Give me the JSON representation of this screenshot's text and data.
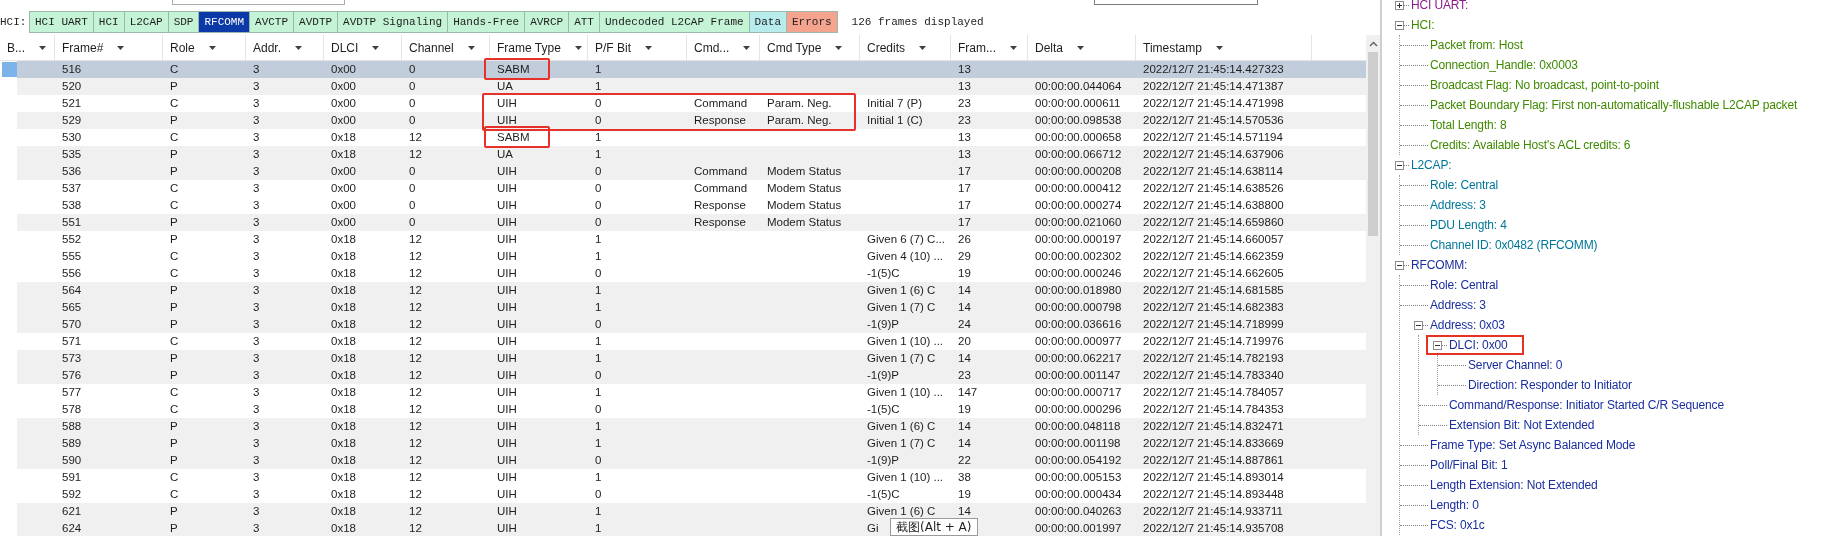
{
  "protocol_bar": {
    "label": "HCI:",
    "tabs": [
      {
        "label": "HCI UART",
        "selected": false,
        "color": "#c4f3d6"
      },
      {
        "label": "HCI",
        "selected": false,
        "color": "#c4f3d6"
      },
      {
        "label": "L2CAP",
        "selected": false,
        "color": "#c4f3d6"
      },
      {
        "label": "SDP",
        "selected": false,
        "color": "#c4f3d6"
      },
      {
        "label": "RFCOMM",
        "selected": true,
        "color": "#0b3aa8"
      },
      {
        "label": "AVCTP",
        "selected": false,
        "color": "#c4f3d6"
      },
      {
        "label": "AVDTP",
        "selected": false,
        "color": "#c4f3d6"
      },
      {
        "label": "AVDTP Signaling",
        "selected": false,
        "color": "#c4f3d6"
      },
      {
        "label": "Hands-Free",
        "selected": false,
        "color": "#c4f3d6"
      },
      {
        "label": "AVRCP",
        "selected": false,
        "color": "#c4f3d6"
      },
      {
        "label": "ATT",
        "selected": false,
        "color": "#c4f3d6"
      },
      {
        "label": "Undecoded L2CAP Frame",
        "selected": false,
        "color": "#c4f3d6"
      },
      {
        "label": "Data",
        "selected": false,
        "color": "#b8ecec"
      },
      {
        "label": "Errors",
        "selected": false,
        "color": "#f4a48e"
      }
    ],
    "frame_count": "126 frames displayed"
  },
  "table": {
    "columns": [
      "B...",
      "Frame#",
      "Role",
      "Addr.",
      "DLCI",
      "Channel",
      "Frame Type",
      "P/F Bit",
      "Cmd...",
      "Cmd Type",
      "Credits",
      "Fram...",
      "Delta",
      "Timestamp"
    ],
    "rows": [
      {
        "selected": true,
        "boxed": true,
        "frame": "516",
        "role": "C",
        "address": "3",
        "dlci": "0x00",
        "channel": "0",
        "frame_type": "SABM",
        "pf_bit": "1",
        "frame_len": "13",
        "timestamp": "2022/12/7 21:45:14.427323"
      },
      {
        "selected": false,
        "shaded": true,
        "frame": "520",
        "role": "P",
        "address": "3",
        "dlci": "0x00",
        "channel": "0",
        "frame_type": "UA",
        "pf_bit": "1",
        "frame_len": "13",
        "delta": "00:00:00.044064",
        "timestamp": "2022/12/7 21:45:14.471387"
      },
      {
        "selected": false,
        "shaded": false,
        "boxed_with_command": true,
        "frame": "521",
        "role": "C",
        "address": "3",
        "dlci": "0x00",
        "channel": "0",
        "frame_type": "UIH",
        "pf_bit": "0",
        "cmd": "Command",
        "cmd_type": "Param. Neg.",
        "credits": "Initial 7 (P)",
        "frame_len": "23",
        "delta": "00:00:00.000611",
        "timestamp": "2022/12/7 21:45:14.471998"
      },
      {
        "selected": false,
        "shaded": true,
        "boxed_with_command": true,
        "frame": "529",
        "role": "P",
        "address": "3",
        "dlci": "0x00",
        "channel": "0",
        "frame_type": "UIH",
        "pf_bit": "0",
        "cmd": "Response",
        "cmd_type": "Param. Neg.",
        "credits": "Initial 1 (C)",
        "frame_len": "23",
        "delta": "00:00:00.098538",
        "timestamp": "2022/12/7 21:45:14.570536"
      },
      {
        "selected": false,
        "shaded": false,
        "boxed": true,
        "frame": "530",
        "role": "C",
        "address": "3",
        "dlci": "0x18",
        "channel": "12",
        "frame_type": "SABM",
        "pf_bit": "1",
        "frame_len": "13",
        "delta": "00:00:00.000658",
        "timestamp": "2022/12/7 21:45:14.571194"
      },
      {
        "selected": false,
        "shaded": true,
        "frame": "535",
        "role": "P",
        "address": "3",
        "dlci": "0x18",
        "channel": "12",
        "frame_type": "UA",
        "pf_bit": "1",
        "frame_len": "13",
        "delta": "00:00:00.066712",
        "timestamp": "2022/12/7 21:45:14.637906"
      },
      {
        "selected": false,
        "shaded": true,
        "frame": "536",
        "role": "P",
        "address": "3",
        "dlci": "0x00",
        "channel": "0",
        "frame_type": "UIH",
        "pf_bit": "0",
        "cmd": "Command",
        "cmd_type": "Modem Status",
        "frame_len": "17",
        "delta": "00:00:00.000208",
        "timestamp": "2022/12/7 21:45:14.638114"
      },
      {
        "selected": false,
        "shaded": false,
        "frame": "537",
        "role": "C",
        "address": "3",
        "dlci": "0x00",
        "channel": "0",
        "frame_type": "UIH",
        "pf_bit": "0",
        "cmd": "Command",
        "cmd_type": "Modem Status",
        "frame_len": "17",
        "delta": "00:00:00.000412",
        "timestamp": "2022/12/7 21:45:14.638526"
      },
      {
        "selected": false,
        "shaded": false,
        "frame": "538",
        "role": "C",
        "address": "3",
        "dlci": "0x00",
        "channel": "0",
        "frame_type": "UIH",
        "pf_bit": "0",
        "cmd": "Response",
        "cmd_type": "Modem Status",
        "frame_len": "17",
        "delta": "00:00:00.000274",
        "timestamp": "2022/12/7 21:45:14.638800"
      },
      {
        "selected": false,
        "shaded": true,
        "frame": "551",
        "role": "P",
        "address": "3",
        "dlci": "0x00",
        "channel": "0",
        "frame_type": "UIH",
        "pf_bit": "0",
        "cmd": "Response",
        "cmd_type": "Modem Status",
        "frame_len": "17",
        "delta": "00:00:00.021060",
        "timestamp": "2022/12/7 21:45:14.659860"
      },
      {
        "selected": false,
        "shaded": false,
        "frame": "552",
        "role": "P",
        "address": "3",
        "dlci": "0x18",
        "channel": "12",
        "frame_type": "UIH",
        "pf_bit": "1",
        "credits": "Given 6 (7) C...",
        "frame_len": "26",
        "delta": "00:00:00.000197",
        "timestamp": "2022/12/7 21:45:14.660057"
      },
      {
        "selected": false,
        "shaded": false,
        "frame": "555",
        "role": "C",
        "address": "3",
        "dlci": "0x18",
        "channel": "12",
        "frame_type": "UIH",
        "pf_bit": "1",
        "credits": "Given 4 (10) ...",
        "frame_len": "29",
        "delta": "00:00:00.002302",
        "timestamp": "2022/12/7 21:45:14.662359"
      },
      {
        "selected": false,
        "shaded": false,
        "frame": "556",
        "role": "C",
        "address": "3",
        "dlci": "0x18",
        "channel": "12",
        "frame_type": "UIH",
        "pf_bit": "0",
        "credits": "-1(5)C",
        "frame_len": "19",
        "delta": "00:00:00.000246",
        "timestamp": "2022/12/7 21:45:14.662605"
      },
      {
        "selected": false,
        "shaded": true,
        "frame": "564",
        "role": "P",
        "address": "3",
        "dlci": "0x18",
        "channel": "12",
        "frame_type": "UIH",
        "pf_bit": "1",
        "credits": "Given 1 (6) C",
        "frame_len": "14",
        "delta": "00:00:00.018980",
        "timestamp": "2022/12/7 21:45:14.681585"
      },
      {
        "selected": false,
        "shaded": true,
        "frame": "565",
        "role": "P",
        "address": "3",
        "dlci": "0x18",
        "channel": "12",
        "frame_type": "UIH",
        "pf_bit": "1",
        "credits": "Given 1 (7) C",
        "frame_len": "14",
        "delta": "00:00:00.000798",
        "timestamp": "2022/12/7 21:45:14.682383"
      },
      {
        "selected": false,
        "shaded": true,
        "frame": "570",
        "role": "P",
        "address": "3",
        "dlci": "0x18",
        "channel": "12",
        "frame_type": "UIH",
        "pf_bit": "0",
        "credits": "-1(9)P",
        "frame_len": "24",
        "delta": "00:00:00.036616",
        "timestamp": "2022/12/7 21:45:14.718999"
      },
      {
        "selected": false,
        "shaded": false,
        "frame": "571",
        "role": "C",
        "address": "3",
        "dlci": "0x18",
        "channel": "12",
        "frame_type": "UIH",
        "pf_bit": "1",
        "credits": "Given 1 (10) ...",
        "frame_len": "20",
        "delta": "00:00:00.000977",
        "timestamp": "2022/12/7 21:45:14.719976"
      },
      {
        "selected": false,
        "shaded": true,
        "frame": "573",
        "role": "P",
        "address": "3",
        "dlci": "0x18",
        "channel": "12",
        "frame_type": "UIH",
        "pf_bit": "1",
        "credits": "Given 1 (7) C",
        "frame_len": "14",
        "delta": "00:00:00.062217",
        "timestamp": "2022/12/7 21:45:14.782193"
      },
      {
        "selected": false,
        "shaded": true,
        "frame": "576",
        "role": "P",
        "address": "3",
        "dlci": "0x18",
        "channel": "12",
        "frame_type": "UIH",
        "pf_bit": "0",
        "credits": "-1(9)P",
        "frame_len": "23",
        "delta": "00:00:00.001147",
        "timestamp": "2022/12/7 21:45:14.783340"
      },
      {
        "selected": false,
        "shaded": false,
        "frame": "577",
        "role": "C",
        "address": "3",
        "dlci": "0x18",
        "channel": "12",
        "frame_type": "UIH",
        "pf_bit": "1",
        "credits": "Given 1 (10) ...",
        "frame_len": "147",
        "delta": "00:00:00.000717",
        "timestamp": "2022/12/7 21:45:14.784057"
      },
      {
        "selected": false,
        "shaded": false,
        "frame": "578",
        "role": "C",
        "address": "3",
        "dlci": "0x18",
        "channel": "12",
        "frame_type": "UIH",
        "pf_bit": "0",
        "credits": "-1(5)C",
        "frame_len": "19",
        "delta": "00:00:00.000296",
        "timestamp": "2022/12/7 21:45:14.784353"
      },
      {
        "selected": false,
        "shaded": true,
        "frame": "588",
        "role": "P",
        "address": "3",
        "dlci": "0x18",
        "channel": "12",
        "frame_type": "UIH",
        "pf_bit": "1",
        "credits": "Given 1 (6) C",
        "frame_len": "14",
        "delta": "00:00:00.048118",
        "timestamp": "2022/12/7 21:45:14.832471"
      },
      {
        "selected": false,
        "shaded": true,
        "frame": "589",
        "role": "P",
        "address": "3",
        "dlci": "0x18",
        "channel": "12",
        "frame_type": "UIH",
        "pf_bit": "1",
        "credits": "Given 1 (7) C",
        "frame_len": "14",
        "delta": "00:00:00.001198",
        "timestamp": "2022/12/7 21:45:14.833669"
      },
      {
        "selected": false,
        "shaded": true,
        "frame": "590",
        "role": "P",
        "address": "3",
        "dlci": "0x18",
        "channel": "12",
        "frame_type": "UIH",
        "pf_bit": "0",
        "credits": "-1(9)P",
        "frame_len": "22",
        "delta": "00:00:00.054192",
        "timestamp": "2022/12/7 21:45:14.887861"
      },
      {
        "selected": false,
        "shaded": false,
        "frame": "591",
        "role": "C",
        "address": "3",
        "dlci": "0x18",
        "channel": "12",
        "frame_type": "UIH",
        "pf_bit": "1",
        "credits": "Given 1 (10) ...",
        "frame_len": "38",
        "delta": "00:00:00.005153",
        "timestamp": "2022/12/7 21:45:14.893014"
      },
      {
        "selected": false,
        "shaded": false,
        "frame": "592",
        "role": "C",
        "address": "3",
        "dlci": "0x18",
        "channel": "12",
        "frame_type": "UIH",
        "pf_bit": "0",
        "credits": "-1(5)C",
        "frame_len": "19",
        "delta": "00:00:00.000434",
        "timestamp": "2022/12/7 21:45:14.893448"
      },
      {
        "selected": false,
        "shaded": true,
        "frame": "621",
        "role": "P",
        "address": "3",
        "dlci": "0x18",
        "channel": "12",
        "frame_type": "UIH",
        "pf_bit": "1",
        "credits": "Given 1 (6) C",
        "frame_len": "14",
        "delta": "00:00:00.040263",
        "timestamp": "2022/12/7 21:45:14.933711"
      },
      {
        "selected": false,
        "shaded": true,
        "frame": "624",
        "role": "P",
        "address": "3",
        "dlci": "0x18",
        "channel": "12",
        "frame_type": "UIH",
        "pf_bit": "1",
        "credits": "Gi",
        "delta": "00:00:00.001997",
        "timestamp": "2022/12/7 21:45:14.935708"
      }
    ]
  },
  "tree": [
    {
      "label": "HCI UART:",
      "expanded": false,
      "color": "#8a1c8c"
    },
    {
      "label": "HCI:",
      "expanded": true,
      "color": "#3f8a00",
      "children": [
        {
          "label": "Packet from: Host"
        },
        {
          "label": "Connection_Handle: 0x0003"
        },
        {
          "label": "Broadcast Flag: No broadcast, point-to-point"
        },
        {
          "label": "Packet Boundary Flag: First non-automatically-flushable L2CAP packet"
        },
        {
          "label": "Total Length: 8"
        },
        {
          "label": "Credits: Available Host's ACL credits: 6"
        }
      ]
    },
    {
      "label": "L2CAP:",
      "expanded": true,
      "color": "#00779a",
      "children": [
        {
          "label": "Role: Central"
        },
        {
          "label": "Address: 3"
        },
        {
          "label": "PDU Length: 4"
        },
        {
          "label": "Channel ID: 0x0482  (RFCOMM)"
        }
      ]
    },
    {
      "label": "RFCOMM:",
      "expanded": true,
      "color": "#1a2ea0",
      "children": [
        {
          "label": "Role: Central"
        },
        {
          "label": "Address: 3"
        },
        {
          "label": "Address: 0x03",
          "expanded": true,
          "children": [
            {
              "label": "DLCI: 0x00",
              "expanded": true,
              "highlighted": true,
              "children": [
                {
                  "label": "Server Channel: 0"
                },
                {
                  "label": "Direction: Responder to Initiator"
                }
              ]
            },
            {
              "label": "Command/Response: Initiator Started C/R Sequence"
            },
            {
              "label": "Extension Bit: Not Extended"
            }
          ]
        },
        {
          "label": "Frame Type: Set Async Balanced Mode"
        },
        {
          "label": "Poll/Final Bit: 1"
        },
        {
          "label": "Length Extension: Not Extended"
        },
        {
          "label": "Length: 0"
        },
        {
          "label": "FCS: 0x1c"
        }
      ]
    }
  ],
  "tooltip": "截图(Alt + A)"
}
